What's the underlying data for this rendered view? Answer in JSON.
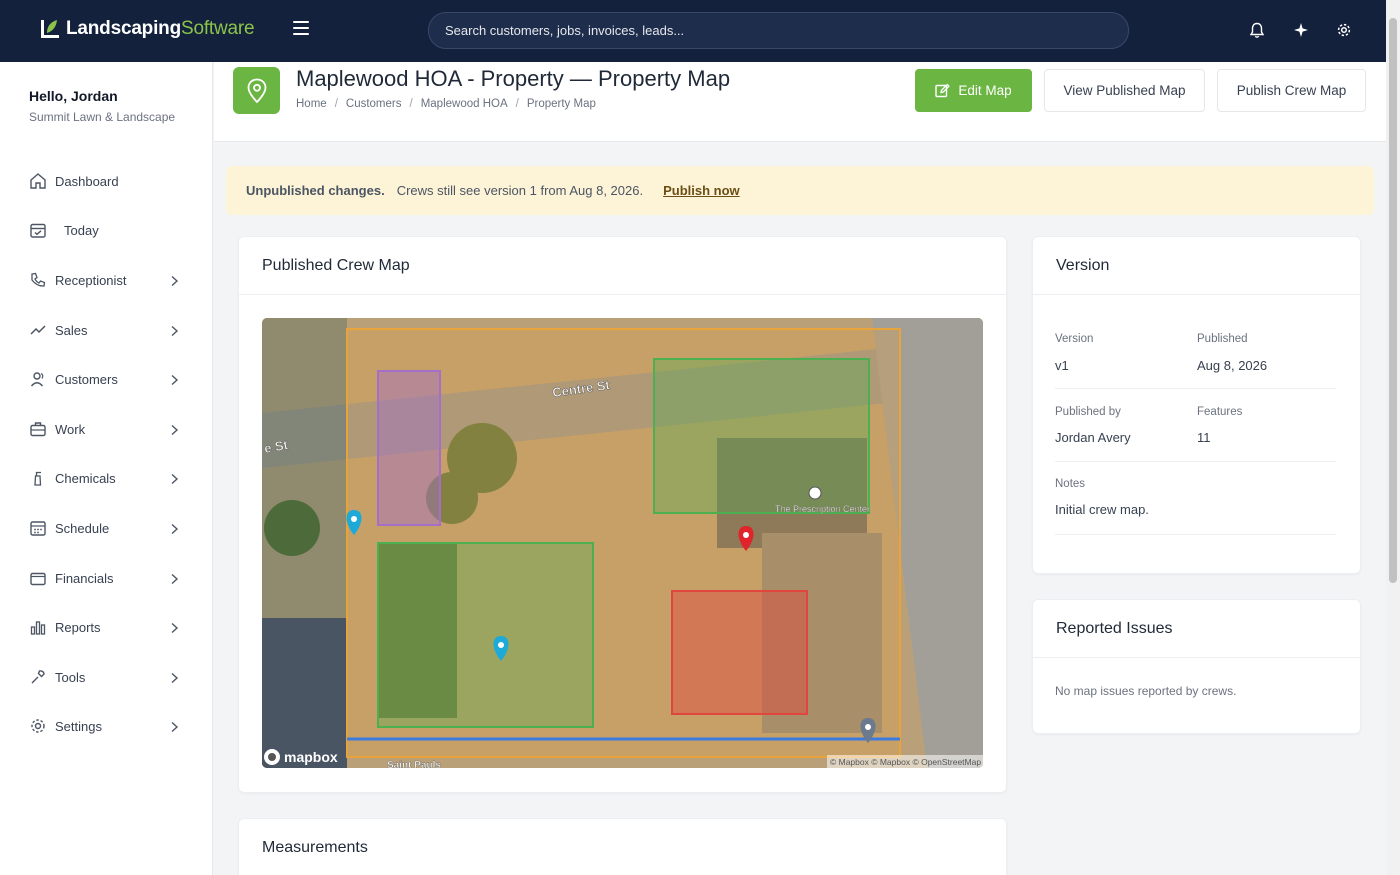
{
  "app": {
    "brand_main": "Landscaping",
    "brand_sub": "Software",
    "search_placeholder": "Search customers, jobs, invoices, leads..."
  },
  "user": {
    "greeting": "Hello, Jordan",
    "company": "Summit Lawn & Landscape"
  },
  "sidebar": {
    "items": [
      {
        "label": "Dashboard",
        "icon": "home-icon",
        "expandable": false
      },
      {
        "label": "Today",
        "icon": "calendar-check-icon",
        "expandable": false
      },
      {
        "label": "Receptionist",
        "icon": "phone-icon",
        "expandable": true
      },
      {
        "label": "Sales",
        "icon": "trend-line-icon",
        "expandable": true
      },
      {
        "label": "Customers",
        "icon": "users-icon",
        "expandable": true
      },
      {
        "label": "Work",
        "icon": "briefcase-icon",
        "expandable": true
      },
      {
        "label": "Chemicals",
        "icon": "spray-bottle-icon",
        "expandable": true
      },
      {
        "label": "Schedule",
        "icon": "calendar-grid-icon",
        "expandable": true
      },
      {
        "label": "Financials",
        "icon": "wallet-icon",
        "expandable": true
      },
      {
        "label": "Reports",
        "icon": "bar-chart-icon",
        "expandable": true
      },
      {
        "label": "Tools",
        "icon": "wrench-icon",
        "expandable": true
      },
      {
        "label": "Settings",
        "icon": "gear-icon",
        "expandable": true
      }
    ]
  },
  "page": {
    "title": "Maplewood HOA - Property — Property Map",
    "breadcrumb": [
      "Home",
      "Customers",
      "Maplewood HOA",
      "Property Map"
    ],
    "buttons": {
      "edit": "Edit Map",
      "view_published": "View Published Map",
      "publish_crew": "Publish Crew Map"
    }
  },
  "banner": {
    "strong": "Unpublished changes.",
    "text": "Crews still see version 1 from Aug 8, 2026.",
    "link": "Publish now"
  },
  "map_card": {
    "title": "Published Crew Map",
    "street_labels": [
      "Centre St",
      "e St",
      "Saint Pauls",
      "The Prescription Center"
    ],
    "attribution": "© Mapbox © Mapbox © OpenStreetMap",
    "logo": "mapbox",
    "colors": {
      "boundary": "#e8a33a",
      "purple_zone": "#a56ec9",
      "green_zone": "#4caf50",
      "red_zone": "#e0463d",
      "line": "#3b7be0"
    }
  },
  "version_card": {
    "title": "Version",
    "version_label": "Version",
    "version_value": "v1",
    "published_label": "Published",
    "published_value": "Aug 8, 2026",
    "published_by_label": "Published by",
    "published_by_value": "Jordan Avery",
    "features_label": "Features",
    "features_value": "11",
    "notes_label": "Notes",
    "notes_value": "Initial crew map."
  },
  "issues_card": {
    "title": "Reported Issues",
    "empty_text": "No map issues reported by crews."
  },
  "measurements_card": {
    "title": "Measurements"
  },
  "theme": {
    "topbar": "#14213d",
    "accent": "#6bb543",
    "banner_bg": "#fdf3d6"
  }
}
